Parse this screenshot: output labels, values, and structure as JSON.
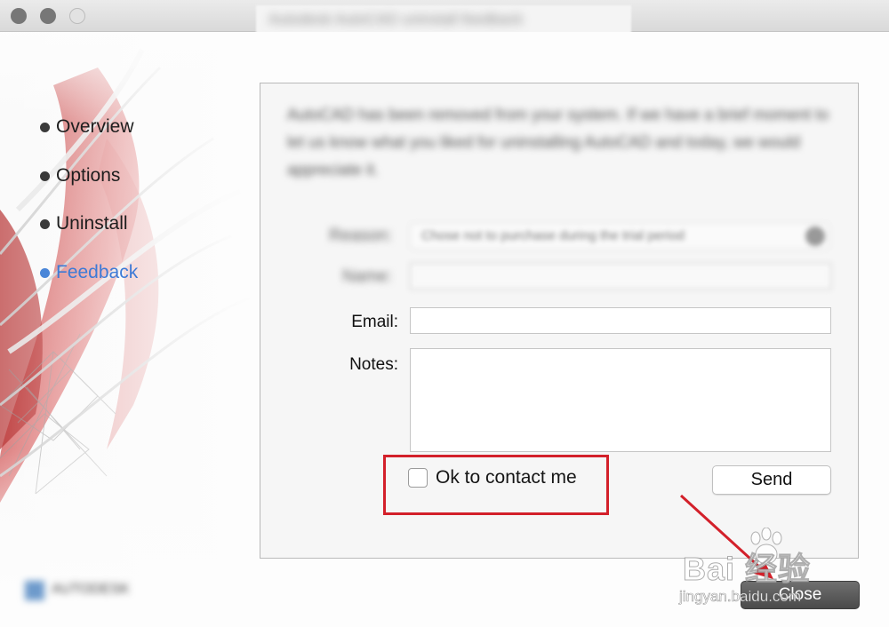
{
  "window": {
    "title": "Autodesk AutoCAD uninstall feedback"
  },
  "sidebar": {
    "items": [
      {
        "label": "Overview",
        "active": false
      },
      {
        "label": "Options",
        "active": false
      },
      {
        "label": "Uninstall",
        "active": false
      },
      {
        "label": "Feedback",
        "active": true
      }
    ],
    "logo_text": "AUTODESK"
  },
  "feedback": {
    "intro_text": "AutoCAD has been removed from your system. If we have a brief moment to let us know what you liked for uninstalling AutoCAD and today, we would appreciate it.",
    "reason_label": "Reason:",
    "reason_value": "Chose not to purchase during the trial period",
    "name_label": "Name:",
    "name_value": "",
    "email_label": "Email:",
    "email_value": "",
    "notes_label": "Notes:",
    "notes_value": "",
    "contact_checkbox_label": "Ok to contact me",
    "contact_checked": false,
    "send_label": "Send"
  },
  "footer": {
    "close_label": "Close"
  },
  "watermark": {
    "brand": "Bai 经验",
    "url": "jingyan.baidu.com"
  },
  "colors": {
    "accent": "#3d7ad6",
    "highlight": "#d3202a"
  }
}
